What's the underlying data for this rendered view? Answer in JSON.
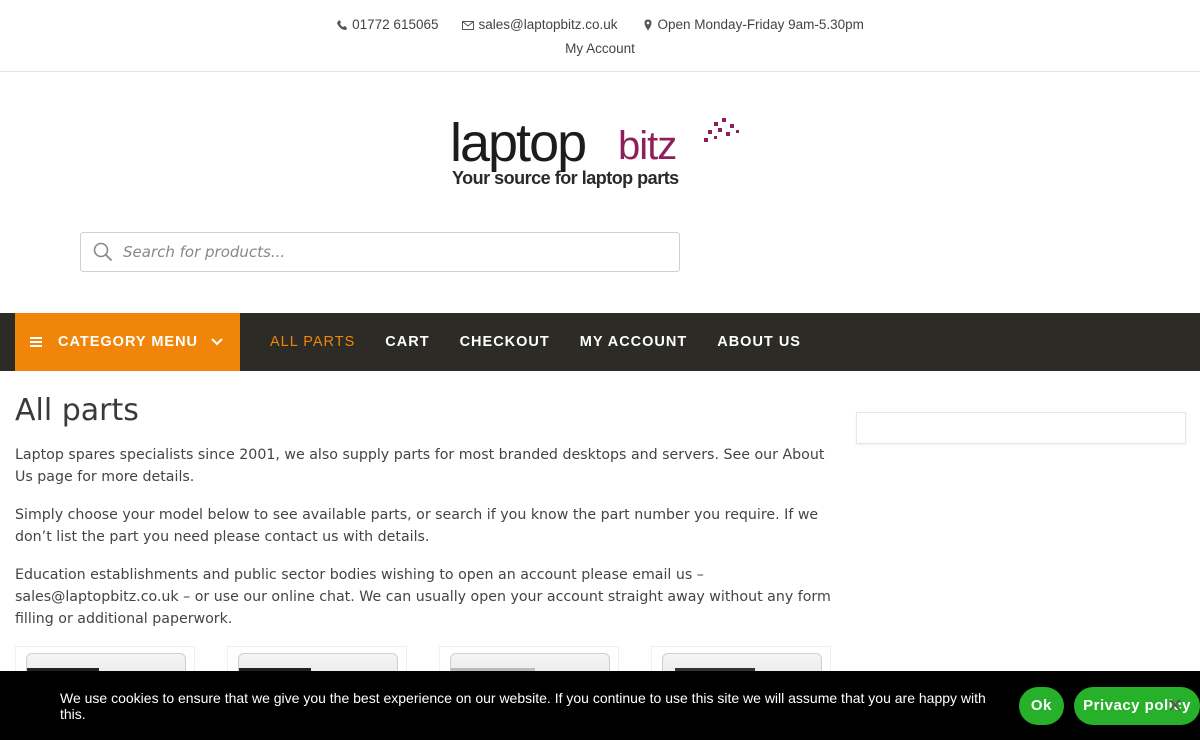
{
  "topbar": {
    "phone": "01772 615065",
    "email": "sales@laptopbitz.co.uk",
    "hours": "Open Monday-Friday 9am-5.30pm",
    "account_link": "My Account",
    "phone_icon": "phone-icon",
    "email_icon": "envelope-icon",
    "location_icon": "map-marker-icon"
  },
  "logo": {
    "word1": "laptop",
    "word2": "bitz",
    "tagline": "Your source for laptop parts"
  },
  "search": {
    "placeholder": "Search for products...",
    "icon": "search-icon"
  },
  "nav": {
    "category_label": "CATEGORY MENU",
    "items": [
      {
        "label": "ALL PARTS",
        "active": true
      },
      {
        "label": "CART"
      },
      {
        "label": "CHECKOUT"
      },
      {
        "label": "MY ACCOUNT"
      },
      {
        "label": "ABOUT US"
      }
    ]
  },
  "page": {
    "title": "All parts",
    "paragraphs": [
      "Laptop spares specialists since 2001, we also supply parts for most branded desktops and servers. See our About Us page for more details.",
      "Simply choose your model below to see available parts, or search if you know the part number you require. If we don’t list the part you need please contact us with details.",
      "Education establishments and public sector bodies wishing to open an account please email us – sales@laptopbitz.co.uk – or use our online chat. We can usually open your account straight away without any form filling or additional paperwork."
    ]
  },
  "cookie": {
    "text": "We use cookies to ensure that we give you the best experience on our website. If you continue to use this site we will assume that you are happy with this.",
    "ok_label": "Ok",
    "privacy_label": "Privacy policy"
  },
  "colors": {
    "accent": "#f0850a",
    "nav_bg": "#2c2b26",
    "brand": "#8e1f5c",
    "cookie_button": "#27b02a"
  }
}
